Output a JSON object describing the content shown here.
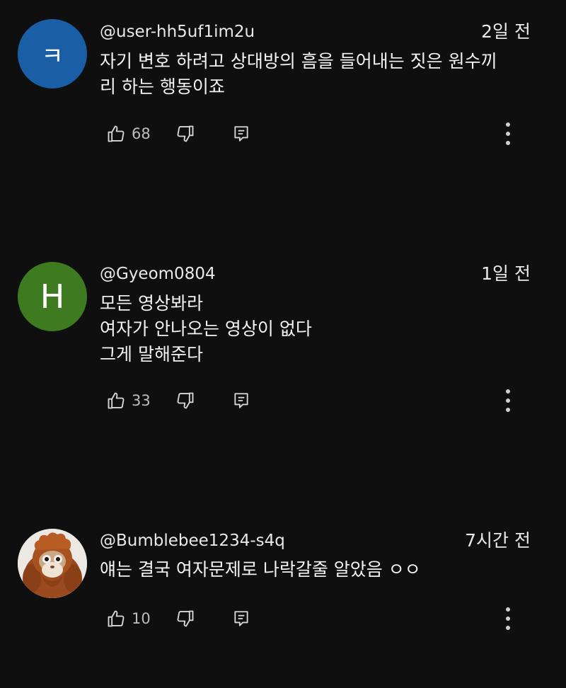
{
  "comments": [
    {
      "avatar_letter": "ㅋ",
      "avatar_color": "#1a5ea5",
      "handle": "@user-hh5uf1im2u",
      "time": "2일 전",
      "lines": [
        "자기 변호 하려고 상대방의 흠을 들어내는 짓은 원수끼",
        "리 하는 행동이죠"
      ],
      "likes": "68"
    },
    {
      "avatar_letter": "H",
      "avatar_color": "#3e7a20",
      "handle": "@Gyeom0804",
      "time": "1일 전",
      "lines": [
        "모든 영상봐라",
        "여자가 안나오는 영상이 없다",
        "그게 말해준다"
      ],
      "likes": "33"
    },
    {
      "avatar_icon": "orangutan-plush-avatar",
      "handle": "@Bumblebee1234-s4q",
      "time": "7시간 전",
      "lines": [
        "얘는 결국 여자문제로 나락갈줄 알았음 ㅇㅇ"
      ],
      "likes": "10"
    }
  ],
  "icons": {
    "like": "thumbs-up-icon",
    "dislike": "thumbs-down-icon",
    "reply": "reply-comment-icon",
    "more": "more-vert-icon"
  },
  "colors": {
    "background": "#0f0f0f",
    "text": "#f1f1f1",
    "secondary_text": "#bdbdbd"
  }
}
